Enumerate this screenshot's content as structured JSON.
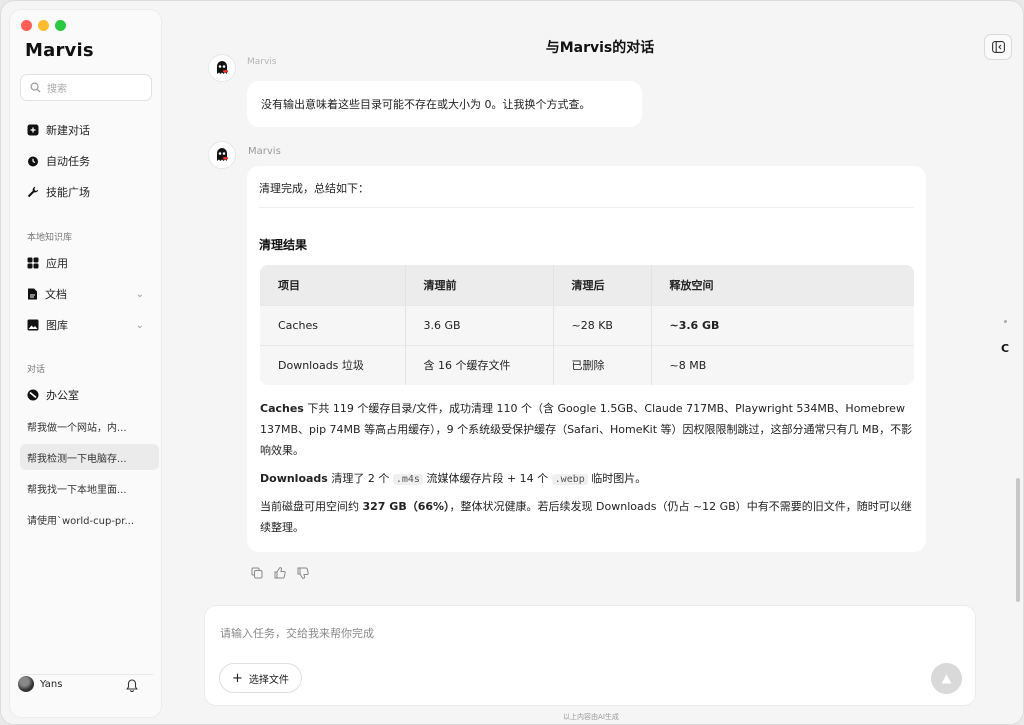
{
  "sidebar": {
    "brand": "Marvis",
    "search_placeholder": "搜索",
    "nav": [
      {
        "label": "新建对话",
        "icon": "new-chat-icon"
      },
      {
        "label": "自动任务",
        "icon": "alarm-clock-icon"
      },
      {
        "label": "技能广场",
        "icon": "wrench-icon"
      }
    ],
    "kb_label": "本地知识库",
    "kb": [
      {
        "label": "应用",
        "icon": "apps-grid-icon"
      },
      {
        "label": "文档",
        "icon": "document-icon"
      },
      {
        "label": "图库",
        "icon": "image-icon"
      }
    ],
    "conv_label": "对话",
    "conversations": [
      {
        "label": "办公室"
      },
      {
        "label": "帮我做一个网站，内..."
      },
      {
        "label": "帮我检测一下电脑存..."
      },
      {
        "label": "帮我找一下本地里面..."
      },
      {
        "label": "请使用`world-cup-pr..."
      }
    ],
    "user": "Yans"
  },
  "header": {
    "title": "与Marvis的对话"
  },
  "messages": {
    "partial_name": "Marvis",
    "m1_text": "没有输出意味着这些目录可能不存在或大小为 0。让我换个方式查。",
    "m2_name": "Marvis",
    "m2_intro": "清理完成，总结如下：",
    "m2_heading": "清理结果",
    "table": {
      "headers": [
        "项目",
        "清理前",
        "清理后",
        "释放空间"
      ],
      "rows": [
        [
          "Caches",
          "3.6 GB",
          "~28 KB",
          "~3.6 GB"
        ],
        [
          "Downloads 垃圾",
          "含 16 个缓存文件",
          "已删除",
          "~8 MB"
        ]
      ]
    },
    "p1_bold": "Caches",
    "p1_text": " 下共 119 个缓存目录/文件，成功清理 110 个（含 Google 1.5GB、Claude 717MB、Playwright 534MB、Homebrew 137MB、pip 74MB 等高占用缓存），9 个系统级受保护缓存（Safari、HomeKit 等）因权限限制跳过，这部分通常只有几 MB，不影响效果。",
    "p2_bold": "Downloads",
    "p2_a": " 清理了 2 个 ",
    "p2_code1": ".m4s",
    "p2_b": " 流媒体缓存片段 + 14 个 ",
    "p2_code2": ".webp",
    "p2_c": " 临时图片。",
    "p3_a": "当前磁盘可用空间约 ",
    "p3_bold": "327 GB（66%）",
    "p3_b": "，整体状况健康。若后续发现 Downloads（仍占 ~12 GB）中有不需要的旧文件，随时可以继续整理。"
  },
  "input": {
    "placeholder": "请输入任务，交给我来帮你完成",
    "file_button": "选择文件"
  },
  "footer_note": "以上内容由AI生成",
  "side_letter": "C"
}
